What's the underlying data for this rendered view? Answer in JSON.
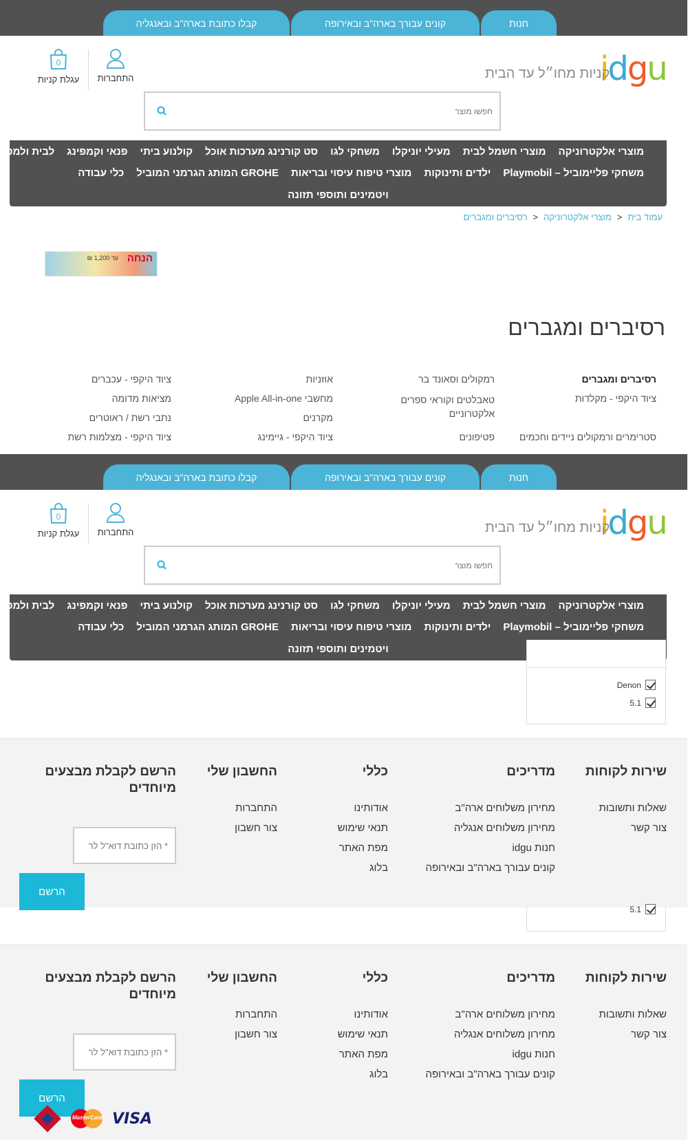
{
  "header": {
    "tabs": [
      "חנות",
      "קונים עבורך בארה\"ב ובאירופה",
      "קבלו כתובת בארה\"ב ובאנגליה"
    ],
    "logo": {
      "letters": [
        "i",
        "d",
        "g",
        "u"
      ],
      "colors": [
        "#f5b400",
        "#3aaad1",
        "#ef5b2c",
        "#8cc63f"
      ]
    },
    "tagline": "קניות מחו״ל עד הבית",
    "login_label": "התחברות",
    "cart_label": "עגלת קניות",
    "cart_count": "0",
    "search_placeholder": "חפשו מוצר",
    "nav_row1": [
      "מוצרי אלקטרוניקה",
      "מוצרי חשמל לבית",
      "מעילי יוניקלו",
      "משחקי לגו",
      "סט קורנינג מערכות אוכל",
      "קולנוע ביתי",
      "פנאי וקמפינג",
      "לבית ולמטבח"
    ],
    "nav_row2": [
      "משחקי פליימוביל – Playmobil",
      "ילדים ותינוקות",
      "מוצרי טיפוח עיסוי ובריאות",
      "GROHE המותג הגרמני המוביל",
      "כלי עבודה"
    ],
    "nav_row3": [
      "ויטמינים ותוספי תזונה"
    ]
  },
  "breadcrumb": [
    "עמוד בית",
    "מוצרי אלקטרוניקה",
    "רסיברים ומגברים"
  ],
  "banner": {
    "headline": "הנחה",
    "sub": "עד 1,200 ₪"
  },
  "page_title": "רסיברים ומגברים",
  "categories": [
    "רסיברים ומגברים",
    "רמקולים וסאונד בר",
    "אוזניות",
    "ציוד היקפי - עכברים",
    "ציוד היקפי - מקלדות",
    "טאבלטים וקוראי ספרים אלקטרוניים",
    "מחשבי Apple All-in-one",
    "מציאות מדומה",
    "מקרנים",
    "נתבי רשת / ראוטרים",
    "סטרימרים ורמקולים ניידים וחכמים",
    "פטיפונים",
    "ציוד היקפי - גיימינג",
    "ציוד היקפי - מצלמות רשת"
  ],
  "filter": {
    "options": [
      "Denon",
      "5.1"
    ],
    "partial_option": "5.1"
  },
  "footer": {
    "columns": [
      {
        "title": "שירות לקוחות",
        "links": [
          "שאלות ותשובות",
          "צור קשר"
        ]
      },
      {
        "title": "מדריכים",
        "links": [
          "מחירון משלוחים ארה\"ב",
          "מחירון משלוחים אנגליה",
          "חנות idgu",
          "קונים עבורך בארה\"ב ובאירופה"
        ]
      },
      {
        "title": "כללי",
        "links": [
          "אודותינו",
          "תנאי שימוש",
          "מפת האתר",
          "בלוג"
        ]
      },
      {
        "title": "החשבון שלי",
        "links": [
          "התחברות",
          "צור חשבון"
        ]
      }
    ],
    "newsletter_title": "הרשם לקבלת מבצעים מיוחדים",
    "newsletter_placeholder": "* הזן כתובת דוא\"ל לר",
    "register_label": "הרשם",
    "payments": [
      "VISA",
      "MasterCard",
      "Isracard"
    ]
  }
}
